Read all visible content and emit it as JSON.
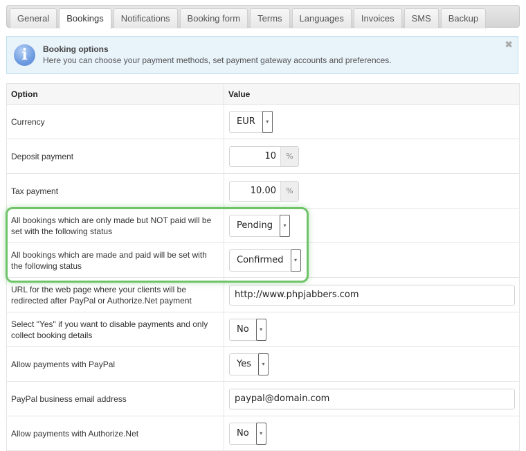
{
  "tabs": [
    {
      "label": "General",
      "active": false
    },
    {
      "label": "Bookings",
      "active": true
    },
    {
      "label": "Notifications",
      "active": false
    },
    {
      "label": "Booking form",
      "active": false
    },
    {
      "label": "Terms",
      "active": false
    },
    {
      "label": "Languages",
      "active": false
    },
    {
      "label": "Invoices",
      "active": false
    },
    {
      "label": "SMS",
      "active": false
    },
    {
      "label": "Backup",
      "active": false
    }
  ],
  "notice": {
    "icon": "info-icon",
    "title": "Booking options",
    "description": "Here you can choose your payment methods, set payment gateway accounts and preferences.",
    "close": "✖"
  },
  "table": {
    "headers": {
      "option": "Option",
      "value": "Value"
    },
    "rows": [
      {
        "label": "Currency",
        "type": "select",
        "value": "EUR"
      },
      {
        "label": "Deposit payment",
        "type": "number",
        "value": "10",
        "unit": "%"
      },
      {
        "label": "Tax payment",
        "type": "number",
        "value": "10.00",
        "unit": "%"
      },
      {
        "label": "All bookings which are only made but NOT paid will be set with the following status",
        "type": "select",
        "value": "Pending"
      },
      {
        "label": "All bookings which are made and paid will be set with the following status",
        "type": "select",
        "value": "Confirmed"
      },
      {
        "label": "URL for the web page where your clients will be redirected after PayPal or Authorize.Net payment",
        "type": "text",
        "value": "http://www.phpjabbers.com"
      },
      {
        "label": "Select \"Yes\" if you want to disable payments and only collect booking details",
        "type": "select",
        "value": "No"
      },
      {
        "label": "Allow payments with PayPal",
        "type": "select",
        "value": "Yes"
      },
      {
        "label": "PayPal business email address",
        "type": "text",
        "value": "paypal@domain.com"
      },
      {
        "label": "Allow payments with Authorize.Net",
        "type": "select",
        "value": "No"
      }
    ]
  },
  "highlight_color": "#6fc46a",
  "arrow_glyph": "▾"
}
